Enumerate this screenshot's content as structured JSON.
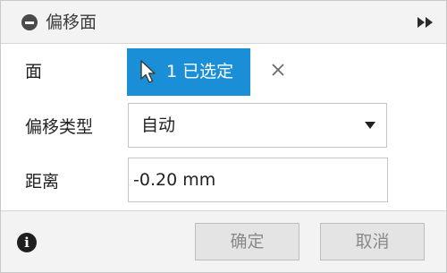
{
  "header": {
    "title": "偏移面",
    "collapse_icon": "minus-circle-icon",
    "expand_icon": "fast-forward-icon"
  },
  "fields": {
    "face": {
      "label": "面",
      "selection_label": "1 已选定",
      "selection_icon": "cursor-arrow-icon",
      "clear_icon": "close-icon"
    },
    "offset_type": {
      "label": "偏移类型",
      "value": "自动"
    },
    "distance": {
      "label": "距离",
      "value": "-0.20 mm"
    }
  },
  "footer": {
    "info_icon": "info-icon",
    "ok_label": "确定",
    "cancel_label": "取消"
  },
  "colors": {
    "accent": "#1a8fd8",
    "panel_bg": "#f3f3f3",
    "content_bg": "#ffffff"
  }
}
